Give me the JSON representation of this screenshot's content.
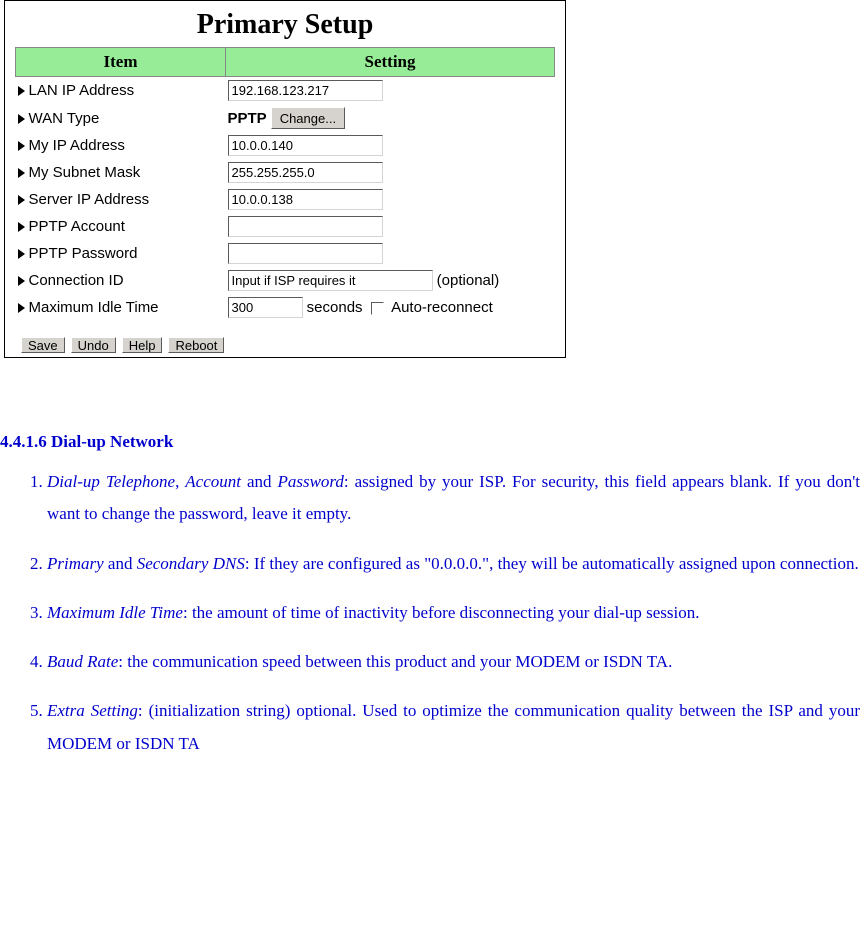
{
  "setup": {
    "title": "Primary Setup",
    "col1": "Item",
    "col2": "Setting",
    "rows": {
      "lan": {
        "label": "LAN IP Address",
        "value": "192.168.123.217"
      },
      "wan": {
        "label": "WAN Type",
        "prefix": "PPTP",
        "button": "Change..."
      },
      "myip": {
        "label": "My IP Address",
        "value": "10.0.0.140"
      },
      "mask": {
        "label": "My Subnet Mask",
        "value": "255.255.255.0"
      },
      "server": {
        "label": "Server IP Address",
        "value": "10.0.0.138"
      },
      "acct": {
        "label": "PPTP Account",
        "value": ""
      },
      "pass": {
        "label": "PPTP Password",
        "value": ""
      },
      "conn": {
        "label": "Connection ID",
        "placeholder": "Input if ISP requires it",
        "suffix": "(optional)"
      },
      "idle": {
        "label": "Maximum Idle Time",
        "value": "300",
        "unit": "seconds",
        "chk": "Auto-reconnect"
      }
    },
    "buttons": {
      "save": "Save",
      "undo": "Undo",
      "help": "Help",
      "reboot": "Reboot"
    }
  },
  "doc": {
    "heading": "4.4.1.6 Dial-up Network",
    "items": [
      {
        "t1": "Dial-up Telephone",
        "sep1": ", ",
        "t2": "Account",
        "sep2": " and ",
        "t3": "Password",
        "rest": ": assigned by your ISP. For security, this field appears blank. If you don't want to change the password, leave it empty."
      },
      {
        "t1": "Primary",
        "sep1": " and ",
        "t2": "Secondary DNS",
        "rest": ": If they are configured as \"0.0.0.0.\", they will be automatically assigned upon connection."
      },
      {
        "t1": "Maximum Idle Time",
        "rest": ": the amount of time of inactivity before disconnecting your dial-up session."
      },
      {
        "t1": "Baud Rate",
        "rest": ": the communication speed between this product and your MODEM or ISDN TA."
      },
      {
        "t1": "Extra Setting",
        "rest": ": (initialization string) optional. Used to optimize the communication quality between the ISP and your MODEM or ISDN TA"
      }
    ]
  }
}
